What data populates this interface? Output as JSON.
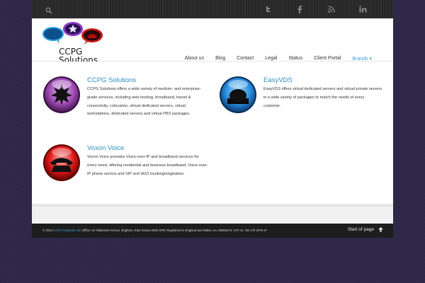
{
  "topbar": {
    "search_icon": "search-icon",
    "social": [
      {
        "name": "twitter",
        "glyph": "t"
      },
      {
        "name": "facebook",
        "glyph": "f"
      },
      {
        "name": "rss",
        "glyph": "rss"
      },
      {
        "name": "linkedin",
        "glyph": "in"
      }
    ]
  },
  "logo": {
    "line1": "CCPG",
    "line2": "Solutions"
  },
  "nav": {
    "items": [
      "About us",
      "Blog",
      "Contact",
      "Legal",
      "Status",
      "Client Portal",
      "Brands ▾"
    ]
  },
  "services": [
    {
      "title": "CCPG Solutions",
      "text": "CCPG Solutions offers a wide variety of medium- and enterprise-grade services, including web hosting, broadband, transit & connectivity, colocation, virtual dedicated servers, virtual workstations, dedicated servers and virtual PBX packages.",
      "color": "#7b2b86"
    },
    {
      "title": "EasyVDS",
      "text": "EasyVDS offers virtual dedicated servers and virtual private servers in a wide variety of packages to match the needs of every customer.",
      "color": "#2c8fd8"
    },
    {
      "title": "Voxon Voice",
      "text": "Voxon Voice provides Voice-over-IP and broadband services for every need, offering residential and business broadband, Voice-over-IP phone service and SIP and IAX2 trunking/origination.",
      "color": "#d01a1a"
    }
  ],
  "footer": {
    "copyright_prefix": "© 2013",
    "company_link": "CCPG Solutions Ltd",
    "copyright_rest": ", Office: 61 Oaklands Avenue, Brighton, East Sussex BN2 6PB; Registered in England and Wales, no. 06652472; VAT no. GB 179 1978 47",
    "top_label": "Start of page"
  }
}
